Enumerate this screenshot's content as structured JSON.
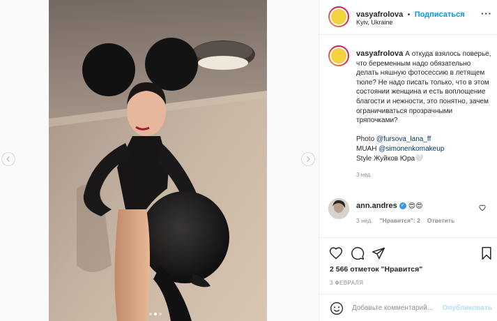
{
  "post": {
    "carousel_dots": 3,
    "active_dot": 1
  },
  "header": {
    "username": "vasyafrolova",
    "separator": "•",
    "follow_label": "Подписаться",
    "location": "Kyiv, Ukraine",
    "more_label": "···"
  },
  "caption": {
    "username": "vasyafrolova",
    "text": "А откуда взялось поверье, что беременным надо обязательно делать няшную фотосессию в летящем тюле? Не надо писать только, что в этом состоянии женщина и есть воплощение благости и нежности, это понятно, зачем ограничиваться прозрачными тряпочками?",
    "credit_photo_prefix": "Photo ",
    "credit_photo_link": "@fursova_lana_ff",
    "credit_muah_prefix": "MUAH ",
    "credit_muah_link": "@simonenkomakeup",
    "credit_style": "Style Жуйков Юра🤍",
    "time": "3 нед."
  },
  "comment": {
    "username": "ann.andres",
    "text": "😍😍",
    "time": "3 нед.",
    "likes": "\"Нравится\": 2",
    "reply": "Ответить"
  },
  "actions": {
    "likes_count": "2 566 отметок \"Нравится\"",
    "date": "3 ФЕВРАЛЯ"
  },
  "add_comment": {
    "placeholder": "Добавьте комментарий...",
    "post_label": "Опубликовать"
  },
  "colors": {
    "link": "#00376b",
    "follow": "#0095f6",
    "muted": "#8e8e8e",
    "post_disabled": "#b2dffc"
  }
}
